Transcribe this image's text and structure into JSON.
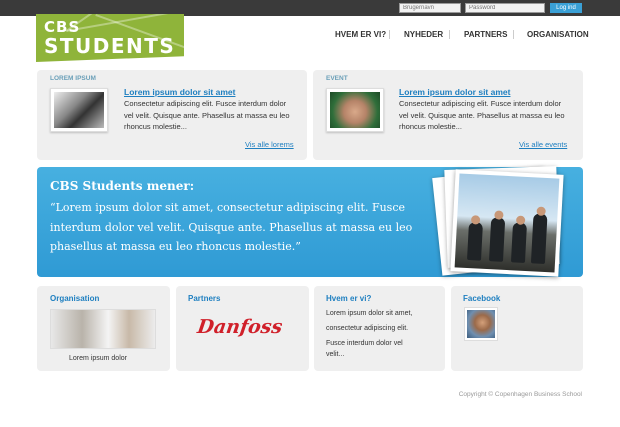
{
  "login": {
    "username_placeholder": "Brugernavn",
    "password_placeholder": "Password",
    "submit_label": "Log ind"
  },
  "logo": {
    "line1": "CBS",
    "line2": "STUDENTS",
    "color": "#8fb43a"
  },
  "nav": {
    "items": [
      "HVEM ER VI?",
      "NYHEDER",
      "PARTNERS",
      "ORGANISATION"
    ]
  },
  "news": {
    "label": "LOREM IPSUM",
    "title": "Lorem ipsum dolor sit amet",
    "body": "Consectetur adipiscing elit. Fusce interdum dolor vel velit. Quisque ante. Phasellus at massa eu leo rhoncus molestie...",
    "link": "Vis alle lorems"
  },
  "event": {
    "label": "EVENT",
    "title": "Lorem ipsum dolor sit amet",
    "body": "Consectetur adipiscing elit. Fusce interdum dolor vel velit. Quisque ante. Phasellus at massa eu leo rhoncus molestie...",
    "link": "Vis alle events"
  },
  "banner": {
    "title": "CBS Students mener:",
    "quote": "“Lorem ipsum dolor sit amet, consectetur adipiscing elit. Fusce interdum dolor vel velit. Quisque ante. Phasellus at massa eu leo phasellus at massa eu leo rhoncus molestie.”",
    "color": "#3aa5da"
  },
  "organisation": {
    "title": "Organisation",
    "caption": "Lorem ipsum dolor"
  },
  "partners": {
    "title": "Partners",
    "logo_text": "Danfoss",
    "logo_color": "#d0202a"
  },
  "about": {
    "title": "Hvem er vi?",
    "lines": [
      "Lorem ipsum dolor sit amet,",
      "consectetur adipiscing elit.",
      "Fusce interdum dolor vel",
      "velit..."
    ]
  },
  "facebook": {
    "title": "Facebook"
  },
  "footer": {
    "copyright": "Copyright © Copenhagen Business School"
  },
  "accent_color": "#1e7fc0"
}
